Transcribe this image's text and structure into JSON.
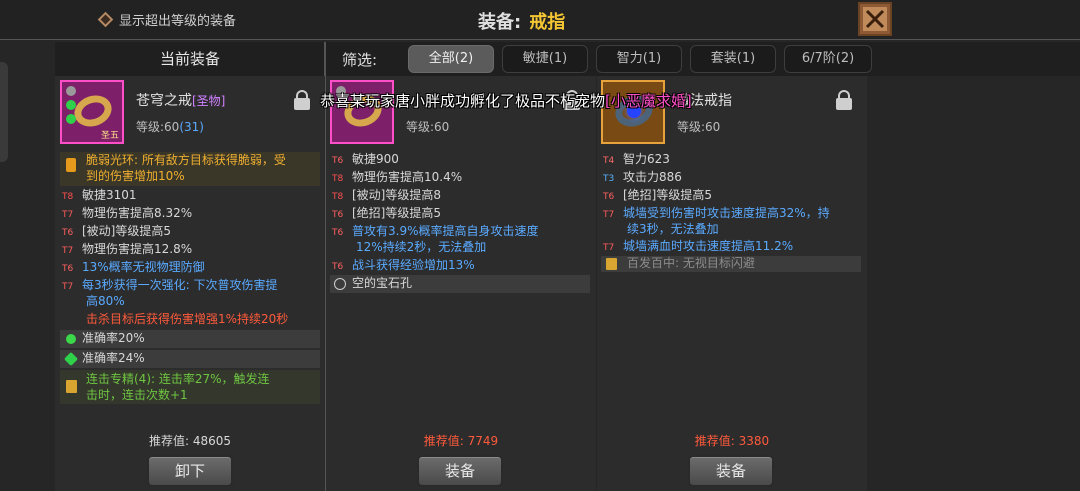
{
  "header": {
    "toggle_label": "显示超出等级的装备",
    "title_prefix": "装备:",
    "title_value": "戒指"
  },
  "current_panel": {
    "heading": "当前装备",
    "item": {
      "name": "苍穹之戒",
      "tag": "[圣物]",
      "badge": "圣五",
      "level_label": "等级:60",
      "level_extra": "(31)"
    },
    "special_lines": [
      "脆弱光环: 所有敌方目标获得脆弱，受",
      "到的伤害增加10%"
    ],
    "stats": [
      {
        "tier": "T8",
        "text": "敏捷3101"
      },
      {
        "tier": "T7",
        "text": "物理伤害提高8.32%"
      },
      {
        "tier": "T6",
        "text": "[被动]等级提高5"
      },
      {
        "tier": "T7",
        "text": "物理伤害提高12.8%"
      },
      {
        "tier": "T6",
        "text": "13%概率无视物理防御"
      },
      {
        "tier": "T7",
        "text": "每3秒获得一次强化: 下次普攻伤害提"
      },
      {
        "tier": "",
        "text": "高80%"
      },
      {
        "tier": "",
        "text": "击杀目标后获得伤害增强1%持续20秒"
      }
    ],
    "gems": [
      {
        "text": "准确率20%"
      },
      {
        "text": "准确率24%"
      }
    ],
    "set_lines": [
      "连击专精(4): 连击率27%，触发连",
      "击时，连击次数+1"
    ],
    "recommend_label": "推荐值:",
    "recommend_value": "48605",
    "button": "卸下"
  },
  "filters": {
    "label": "筛选:",
    "chips": [
      "全部(2)",
      "敏捷(1)",
      "智力(1)",
      "套装(1)",
      "6/7阶(2)"
    ]
  },
  "candidate1": {
    "level_label": "等级:60",
    "stats": [
      {
        "tier": "T6",
        "text": "敏捷900"
      },
      {
        "tier": "T8",
        "text": "物理伤害提高10.4%"
      },
      {
        "tier": "T8",
        "text": "[被动]等级提高8"
      },
      {
        "tier": "T6",
        "text": "[绝招]等级提高5"
      },
      {
        "tier": "T6",
        "text": "普攻有3.9%概率提高自身攻击速度"
      },
      {
        "tier": "",
        "text": "12%持续2秒，无法叠加"
      },
      {
        "tier": "T6",
        "text": "战斗获得经验增加13%"
      }
    ],
    "socket": "空的宝石孔",
    "recommend_label": "推荐值:",
    "recommend_value": "7749",
    "button": "装备"
  },
  "candidate2": {
    "name": "傲法戒指",
    "level_label": "等级:60",
    "stats": [
      {
        "tier": "T4",
        "text": "智力623"
      },
      {
        "tier": "T3",
        "text": "攻击力886"
      },
      {
        "tier": "T6",
        "text": "[绝招]等级提高5"
      },
      {
        "tier": "T7",
        "text": "城墙受到伤害时攻击速度提高32%，持"
      },
      {
        "tier": "",
        "text": "续3秒，无法叠加"
      },
      {
        "tier": "T7",
        "text": "城墙满血时攻击速度提高11.2%"
      }
    ],
    "set_line": "百发百中: 无视目标闪避",
    "recommend_label": "推荐值:",
    "recommend_value": "3380",
    "button": "装备"
  },
  "broadcast": {
    "prefix": "恭喜某玩家唐小胖成功孵化了极品不朽宠物",
    "pet": "[小恶魔求婚]"
  }
}
